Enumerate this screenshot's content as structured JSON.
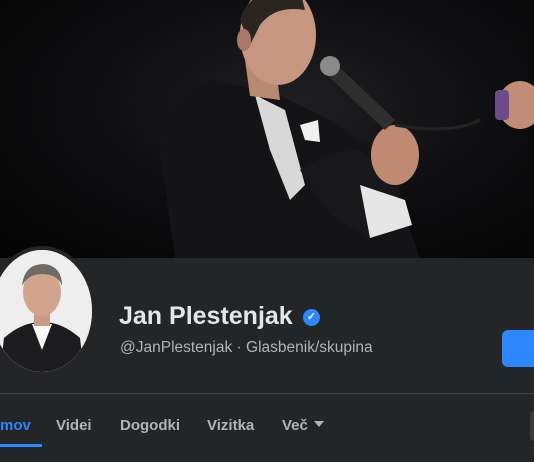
{
  "profile": {
    "name": "Jan Plestenjak",
    "handle_category": "@JanPlestenjak · Glasbenik/skupina",
    "verified_icon": "verified-check-icon"
  },
  "tabs": [
    {
      "label": "mov",
      "active": true
    },
    {
      "label": "Videi",
      "active": false
    },
    {
      "label": "Dogodki",
      "active": false
    },
    {
      "label": "Vizitka",
      "active": false
    },
    {
      "label": "Več",
      "active": false
    }
  ],
  "colors": {
    "background": "#242526",
    "accent": "#2d88ff",
    "text_primary": "#e4e6eb",
    "text_secondary": "#b0b3b8"
  }
}
